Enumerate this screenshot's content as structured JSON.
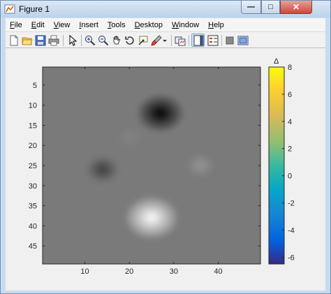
{
  "window": {
    "title": "Figure 1",
    "controls": {
      "minimize": "—",
      "maximize": "□",
      "close": "✕"
    }
  },
  "menu": [
    {
      "label": "File",
      "accel": "F",
      "rest": "ile"
    },
    {
      "label": "Edit",
      "accel": "E",
      "rest": "dit"
    },
    {
      "label": "View",
      "accel": "V",
      "rest": "iew"
    },
    {
      "label": "Insert",
      "accel": "I",
      "rest": "nsert"
    },
    {
      "label": "Tools",
      "accel": "T",
      "rest": "ools"
    },
    {
      "label": "Desktop",
      "accel": "D",
      "rest": "esktop"
    },
    {
      "label": "Window",
      "accel": "W",
      "rest": "indow"
    },
    {
      "label": "Help",
      "accel": "H",
      "rest": "elp"
    }
  ],
  "toolbar": [
    "new-figure-icon",
    "open-file-icon",
    "save-icon",
    "print-icon",
    "pointer-icon",
    "zoom-in-icon",
    "zoom-out-icon",
    "pan-hand-icon",
    "rotate-3d-icon",
    "data-cursor-icon",
    "brush-icon",
    "brush-dropdown-icon",
    "link-plot-icon",
    "insert-colorbar-icon",
    "insert-legend-icon",
    "hide-plot-tools-icon",
    "show-plot-tools-icon"
  ],
  "plot": {
    "x_ticks": [
      "10",
      "20",
      "30",
      "40"
    ],
    "y_ticks": [
      "5",
      "10",
      "15",
      "20",
      "25",
      "30",
      "35",
      "40",
      "45"
    ],
    "colorbar_title": "Δ",
    "colorbar_ticks": [
      "8",
      "6",
      "4",
      "2",
      "0",
      "-2",
      "-4",
      "-6"
    ]
  },
  "chart_data": {
    "type": "heatmap",
    "colormap": "gray",
    "x_range": [
      1,
      49
    ],
    "y_range": [
      1,
      49
    ],
    "y_direction": "reversed",
    "x_ticks": [
      10,
      20,
      30,
      40
    ],
    "y_ticks": [
      5,
      10,
      15,
      20,
      25,
      30,
      35,
      40,
      45
    ],
    "color_limits": [
      -6.5,
      8
    ],
    "colorbar": {
      "colormap": "parula",
      "label": "Δ",
      "ticks": [
        8,
        6,
        4,
        2,
        0,
        -2,
        -4,
        -6
      ]
    },
    "features": [
      {
        "kind": "minimum",
        "x": 27,
        "y": 12,
        "value": -6.5
      },
      {
        "kind": "maximum",
        "x": 25,
        "y": 38,
        "value": 8
      },
      {
        "kind": "minimum",
        "x": 14,
        "y": 26,
        "value": -3
      },
      {
        "kind": "maximum",
        "x": 36,
        "y": 25,
        "value": 2
      },
      {
        "kind": "maximum",
        "x": 20,
        "y": 18,
        "value": 1
      }
    ]
  }
}
